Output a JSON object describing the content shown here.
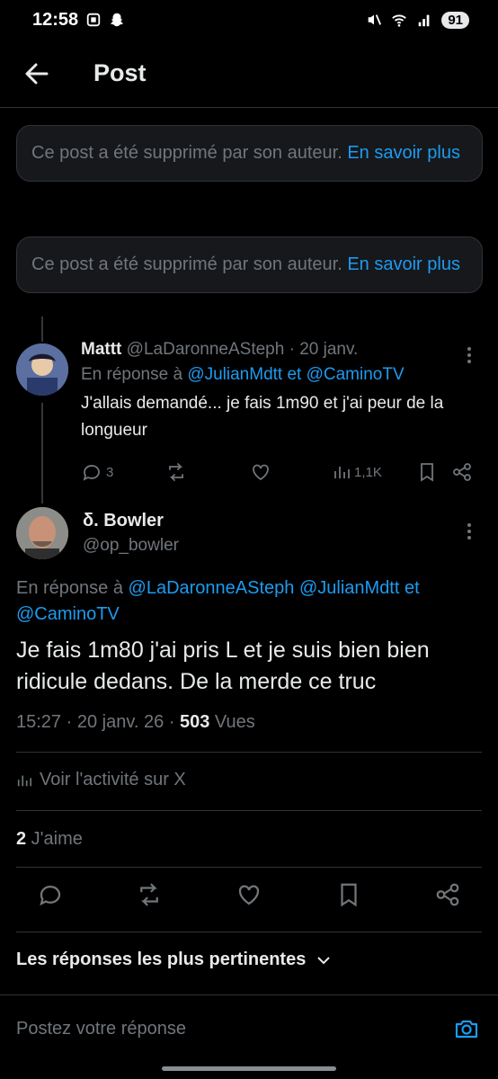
{
  "status_bar": {
    "time": "12:58",
    "battery": "91"
  },
  "header": {
    "title": "Post"
  },
  "deleted_notices": [
    {
      "text": "Ce post a été supprimé par son auteur. ",
      "link": "En savoir plus"
    },
    {
      "text": "Ce post a été supprimé par son auteur. ",
      "link": "En savoir plus"
    }
  ],
  "reply": {
    "name": "Mattt",
    "handle": "@LaDaronneASteph",
    "date": "· 20 janv.",
    "in_reply_prefix": "En réponse à ",
    "mention_1": "@JulianMdtt",
    "joiner": " et ",
    "mention_2": "@CaminoTV",
    "text": "J'allais demandé... je fais 1m90 et j'ai peur de la longueur",
    "reply_count": "3",
    "views": "1,1K"
  },
  "main_post": {
    "name": "δ. Bowler",
    "handle": "@op_bowler",
    "in_reply_prefix": "En réponse à ",
    "mention_1": "@LaDaronneASteph",
    "mention_2": "@JulianMdtt",
    "joiner": " et ",
    "mention_3": "@CaminoTV",
    "text": "Je fais 1m80 j'ai pris L et je suis bien bien ridicule dedans. De la merde ce truc",
    "time": "15:27 · 20 janv. 26 · ",
    "views_count": "503",
    "views_label": " Vues",
    "activity_label": "Voir l'activité sur X",
    "likes_count": "2",
    "likes_label": " J'aime"
  },
  "replies_sort": {
    "label": "Les réponses les plus pertinentes"
  },
  "compose": {
    "placeholder": "Postez votre réponse"
  },
  "colors": {
    "accent": "#1d9bf0",
    "muted": "#71767b",
    "background": "#000000"
  }
}
